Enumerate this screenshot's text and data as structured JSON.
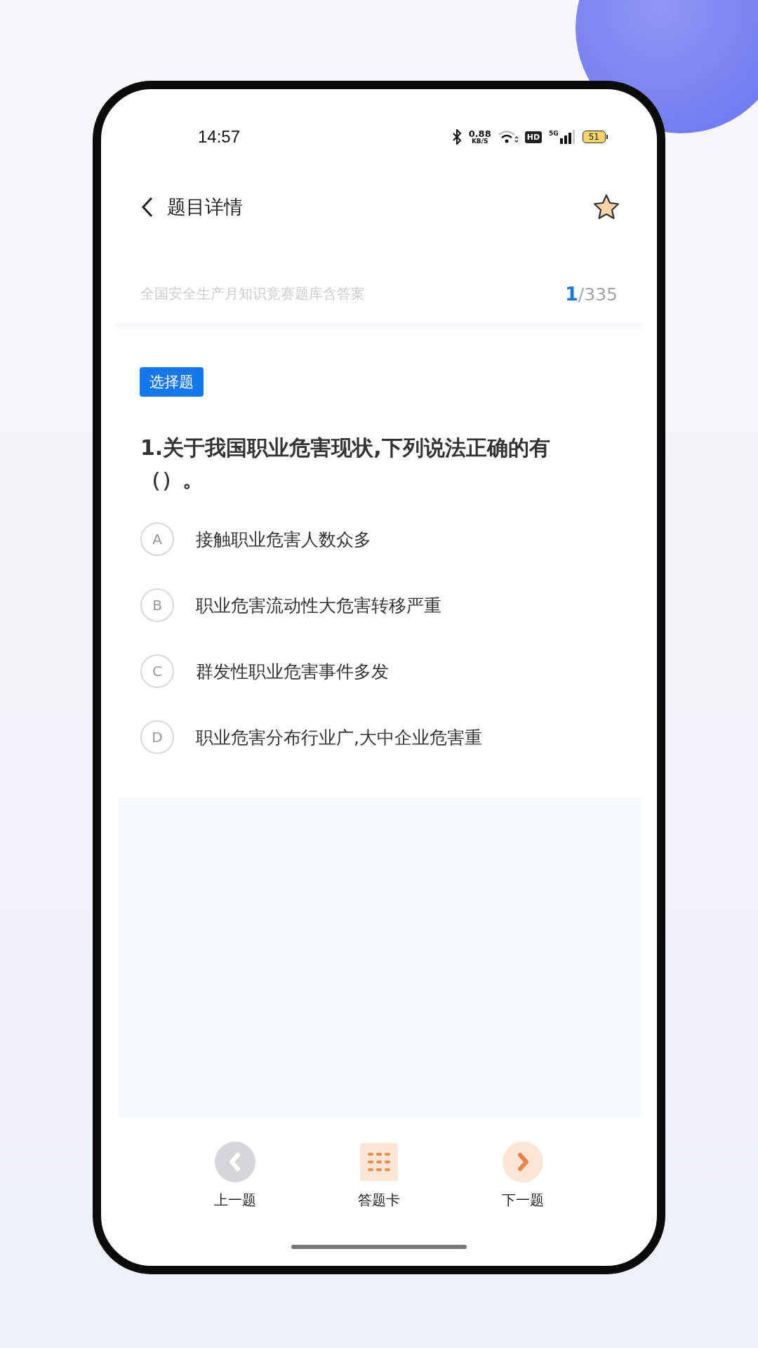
{
  "status_bar": {
    "time": "14:57",
    "speed_value": "0.88",
    "speed_unit": "KB/S",
    "hd": "HD",
    "network": "5G",
    "battery": "51"
  },
  "header": {
    "title": "题目详情"
  },
  "bank": {
    "name": "全国安全生产月知识竞赛题库含答案",
    "current": "1",
    "total": "/335"
  },
  "question": {
    "type_tag": "选择题",
    "text": "1.关于我国职业危害现状,下列说法正确的有（）。",
    "options": [
      {
        "letter": "A",
        "text": "接触职业危害人数众多",
        "selected": false
      },
      {
        "letter": "B",
        "text": "职业危害流动性大危害转移严重",
        "selected": false
      },
      {
        "letter": "C",
        "text": "群发性职业危害事件多发",
        "selected": false
      },
      {
        "letter": "D",
        "text": "职业危害分布行业广,大中企业危害重",
        "selected": false
      }
    ]
  },
  "bottom_nav": [
    {
      "kind": "prev",
      "label": "上一题"
    },
    {
      "kind": "card",
      "label": "答题卡"
    },
    {
      "kind": "next",
      "label": "下一题"
    }
  ]
}
